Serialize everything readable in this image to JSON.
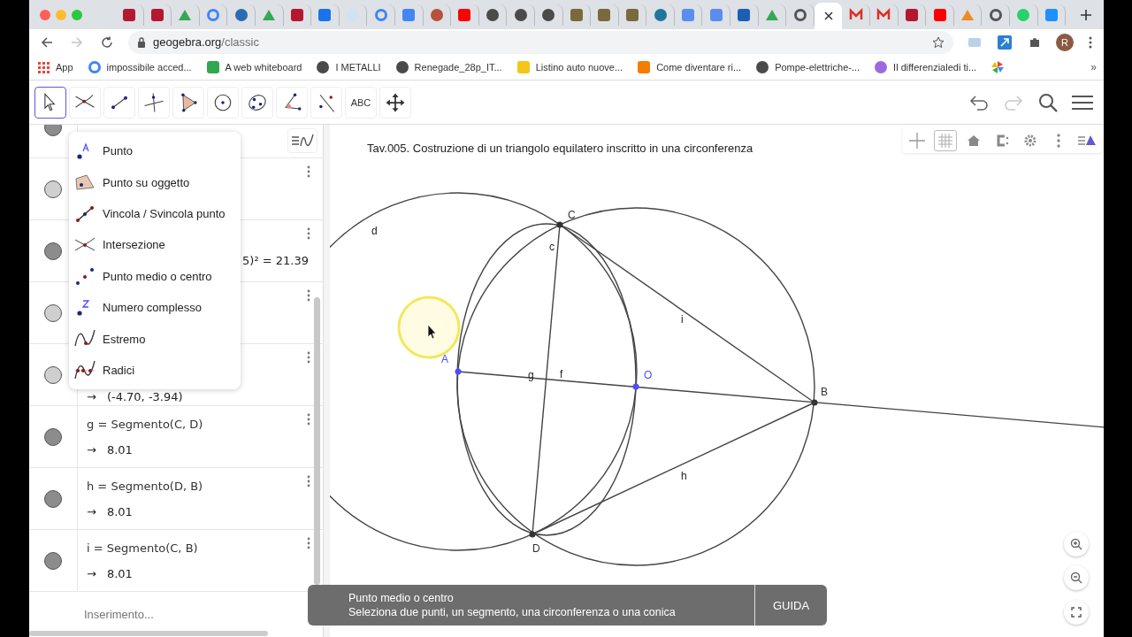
{
  "browser": {
    "tabs": [
      {
        "kind": "is",
        "selected": false
      },
      {
        "kind": "is",
        "selected": false
      },
      {
        "kind": "drive",
        "selected": false
      },
      {
        "kind": "google",
        "selected": false
      },
      {
        "kind": "box",
        "selected": false
      },
      {
        "kind": "drive",
        "selected": false
      },
      {
        "kind": "is",
        "selected": false
      },
      {
        "kind": "contact",
        "selected": false
      },
      {
        "kind": "disc",
        "selected": false
      },
      {
        "kind": "google",
        "selected": false
      },
      {
        "kind": "docs",
        "selected": false
      },
      {
        "kind": "pizza",
        "selected": false
      },
      {
        "kind": "youtube",
        "selected": false
      },
      {
        "kind": "globe",
        "selected": false
      },
      {
        "kind": "globe",
        "selected": false
      },
      {
        "kind": "globe",
        "selected": false
      },
      {
        "kind": "cl",
        "selected": false
      },
      {
        "kind": "cl",
        "selected": false
      },
      {
        "kind": "cl",
        "selected": false
      },
      {
        "kind": "wp",
        "selected": false
      },
      {
        "kind": "cloud",
        "selected": false
      },
      {
        "kind": "cloud",
        "selected": false
      },
      {
        "kind": "lc",
        "selected": false
      },
      {
        "kind": "drive",
        "selected": false
      },
      {
        "kind": "flower",
        "selected": false
      },
      {
        "selected": true
      },
      {
        "kind": "gmail",
        "selected": false
      },
      {
        "kind": "gmail",
        "selected": false
      },
      {
        "kind": "is",
        "selected": false
      },
      {
        "kind": "youtube",
        "selected": false
      },
      {
        "kind": "aorange",
        "selected": false
      },
      {
        "kind": "flower",
        "selected": false
      },
      {
        "kind": "chat",
        "selected": false
      },
      {
        "kind": "appstore",
        "selected": false
      }
    ],
    "url_host": "geogebra.org",
    "url_path": "/classic",
    "avatar": "R",
    "bookmarks": [
      {
        "kind": "apps",
        "label": "App"
      },
      {
        "kind": "google",
        "label": "impossibile acced..."
      },
      {
        "kind": "whiteboard",
        "label": "A web whiteboard"
      },
      {
        "kind": "globe",
        "label": "I METALLI"
      },
      {
        "kind": "globe",
        "label": "Renegade_28p_IT..."
      },
      {
        "kind": "yellow",
        "label": "Listino auto nuove..."
      },
      {
        "kind": "blogger",
        "label": "Come diventare ri..."
      },
      {
        "kind": "globe",
        "label": "Pompe-elettriche-..."
      },
      {
        "kind": "colorful",
        "label": "Il differenzialedi ti..."
      },
      {
        "kind": "pinwheel"
      }
    ],
    "bookmarks_more": "»"
  },
  "toolbar": {
    "tools": [
      {
        "kind": "move",
        "selected": true
      },
      {
        "kind": "intersect",
        "selected": false
      },
      {
        "kind": "segment",
        "selected": false
      },
      {
        "kind": "perpendicular",
        "selected": false
      },
      {
        "kind": "polygon",
        "selected": false
      },
      {
        "kind": "circle",
        "selected": false
      },
      {
        "kind": "conic",
        "selected": false
      },
      {
        "kind": "angle",
        "selected": false
      },
      {
        "kind": "reflect",
        "selected": false
      },
      {
        "kind": "text",
        "label": "ABC",
        "selected": false
      },
      {
        "kind": "pan",
        "selected": false
      }
    ],
    "redo_disabled": true
  },
  "algebra": {
    "rows": [
      {
        "kind": "hidden",
        "visible": true
      },
      {
        "kind": "hidden",
        "visible": false
      },
      {
        "kind": "partial",
        "visible": true,
        "value": "5)² = 21.39"
      },
      {
        "kind": "hidden",
        "visible": false
      },
      {
        "kind": "partial-left",
        "visible": false,
        "arrow": "→",
        "value": "(-4.70, -3.94)"
      },
      {
        "kind": "full",
        "visible": true,
        "definition": "g = Segmento(C, D)",
        "arrow": "→",
        "value": "8.01"
      },
      {
        "kind": "full",
        "visible": true,
        "definition": "h = Segmento(D, B)",
        "arrow": "→",
        "value": "8.01"
      },
      {
        "kind": "full",
        "visible": true,
        "definition": "i = Segmento(C, B)",
        "arrow": "→",
        "value": "8.01"
      }
    ],
    "input_placeholder": "Inserimento..."
  },
  "tool_menu": {
    "items": [
      {
        "kind": "point",
        "label": "Punto"
      },
      {
        "kind": "point-on-object",
        "label": "Punto su oggetto"
      },
      {
        "kind": "attach",
        "label": "Vincola / Svincola punto"
      },
      {
        "kind": "intersect",
        "label": "Intersezione"
      },
      {
        "kind": "midpoint",
        "label": "Punto medio o centro"
      },
      {
        "kind": "complex",
        "label": "Numero complesso"
      },
      {
        "kind": "extremum",
        "label": "Estremo"
      },
      {
        "kind": "roots",
        "label": "Radici"
      }
    ]
  },
  "graphics": {
    "title": "Tav.005. Costruzione di un triangolo equilatero inscritto in una circonferenza",
    "shapes": [
      {
        "kind": "circle",
        "label": "d"
      },
      {
        "kind": "ellipse",
        "label": "c"
      },
      {
        "kind": "circle"
      },
      {
        "kind": "line",
        "label": "f"
      },
      {
        "kind": "segment",
        "label": "g"
      },
      {
        "kind": "segment",
        "label": "h"
      },
      {
        "kind": "segment",
        "label": "i"
      }
    ],
    "points": [
      {
        "label": "A",
        "color": "#4d4dff"
      },
      {
        "label": "O",
        "color": "#4d4dff"
      },
      {
        "label": "B",
        "color": "#333333"
      },
      {
        "label": "C",
        "color": "#333333"
      },
      {
        "label": "D",
        "color": "#333333"
      }
    ]
  },
  "toast": {
    "title": "Punto medio o centro",
    "description": "Seleziona due punti, un segmento, una circonferenza o una conica",
    "button": "GUIDA"
  }
}
